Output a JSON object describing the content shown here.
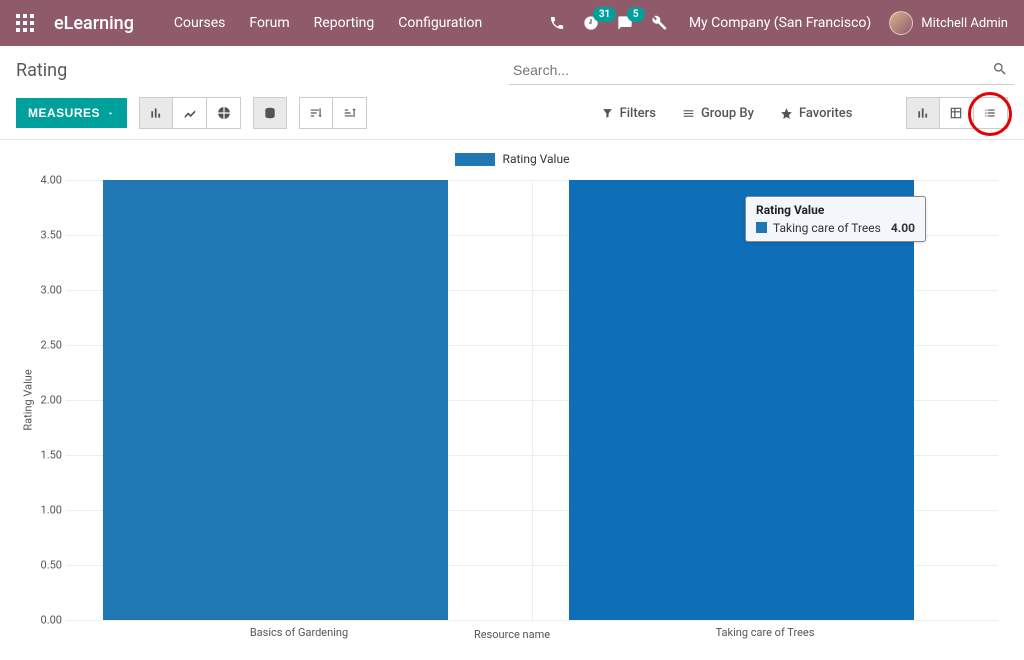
{
  "topbar": {
    "brand": "eLearning",
    "menu": [
      "Courses",
      "Forum",
      "Reporting",
      "Configuration"
    ],
    "activities_badge": "31",
    "messages_badge": "5",
    "company": "My Company (San Francisco)",
    "user": "Mitchell Admin"
  },
  "page": {
    "title": "Rating",
    "search_placeholder": "Search..."
  },
  "toolbar": {
    "measures_label": "MEASURES",
    "filters_label": "Filters",
    "groupby_label": "Group By",
    "favorites_label": "Favorites"
  },
  "chart_data": {
    "type": "bar",
    "title": "",
    "legend": "Rating Value",
    "xlabel": "Resource name",
    "ylabel": "Rating Value",
    "ylim": [
      0,
      4
    ],
    "ytick_step": 0.5,
    "categories": [
      "Basics of Gardening",
      "Taking care of Trees"
    ],
    "values": [
      4.0,
      4.0
    ],
    "hover_index": 1,
    "tooltip": {
      "title": "Rating Value",
      "label": "Taking care of Trees",
      "value": "4.00"
    }
  }
}
